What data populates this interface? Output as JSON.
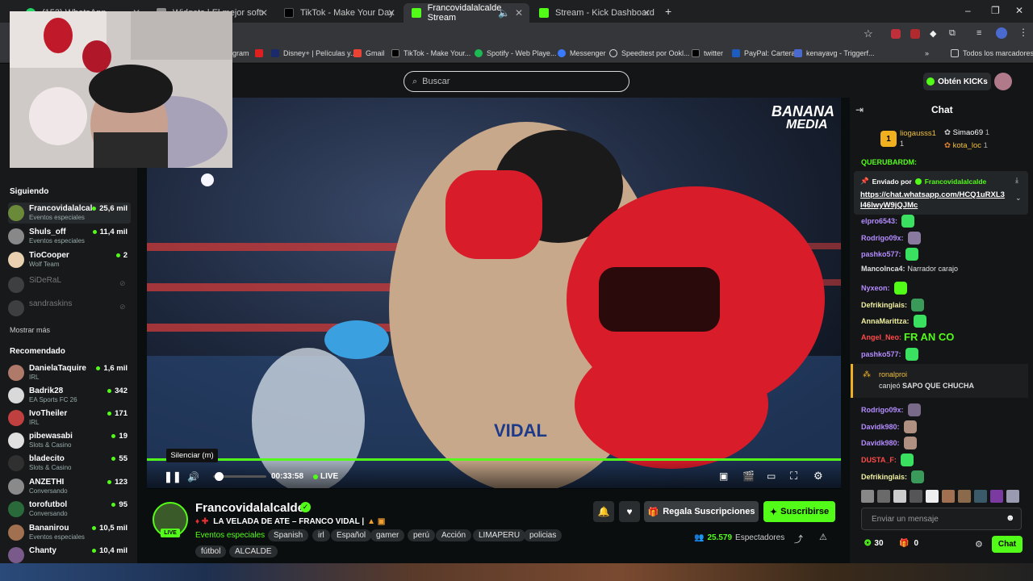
{
  "browser": {
    "tabs": [
      {
        "label": "(153) WhatsApp",
        "color": "#25d366"
      },
      {
        "label": "Widgets | El mejor software pa",
        "color": "#8a8a8a"
      },
      {
        "label": "TikTok - Make Your Day",
        "color": "#111111"
      },
      {
        "label": "Francovidalalcalde Stream",
        "color": "#53fc18"
      },
      {
        "label": "Stream - Kick Dashboard",
        "color": "#53fc18"
      }
    ],
    "new_tab": "+",
    "bookmarks": [
      "gram",
      "Disney+ | Películas y...",
      "Gmail",
      "TikTok - Make Your...",
      "Spotify - Web Playe...",
      "Messenger",
      "Speedtest por Ookl...",
      "twitter",
      "PayPal: Cartera",
      "kenayavg - Triggerf..."
    ],
    "all_bookmarks": "Todos los marcadores"
  },
  "header": {
    "search_placeholder": "Buscar",
    "kicks_button": "Obtén KICKs"
  },
  "sidebar": {
    "following_title": "Siguiendo",
    "following": [
      {
        "name": "Francovidalalcalde",
        "category": "Eventos especiales",
        "viewers": "25,6 mil",
        "color": "#6a8a3a"
      },
      {
        "name": "Shuls_off",
        "category": "Eventos especiales",
        "viewers": "11,4 mil",
        "color": "#888888"
      },
      {
        "name": "TioCooper",
        "category": "Wolf Team",
        "viewers": "2",
        "color": "#e8d0b0"
      },
      {
        "name": "SiDeRaL",
        "category": "",
        "viewers": "",
        "color": "#777777"
      },
      {
        "name": "sandraskins",
        "category": "",
        "viewers": "",
        "color": "#777777"
      }
    ],
    "show_more": "Mostrar más",
    "recommended_title": "Recomendado",
    "recommended": [
      {
        "name": "DanielaTaquire",
        "category": "IRL",
        "viewers": "1,6 mil",
        "color": "#b07a6a"
      },
      {
        "name": "Badrik28",
        "category": "EA Sports FC 26",
        "viewers": "342",
        "color": "#d9d9d9"
      },
      {
        "name": "IvoTheiler",
        "category": "IRL",
        "viewers": "171",
        "color": "#c04040"
      },
      {
        "name": "pibewasabi",
        "category": "Slots & Casino",
        "viewers": "19",
        "color": "#e0e0e0"
      },
      {
        "name": "bladecito",
        "category": "Slots & Casino",
        "viewers": "55",
        "color": "#303030"
      },
      {
        "name": "ANZETHI",
        "category": "Conversando",
        "viewers": "123",
        "color": "#8a8a8a"
      },
      {
        "name": "torofutbol",
        "category": "Conversando",
        "viewers": "95",
        "color": "#2a6a3a"
      },
      {
        "name": "Bananirou",
        "category": "Eventos especiales",
        "viewers": "10,5 mil",
        "color": "#a07050"
      },
      {
        "name": "Chanty",
        "category": "",
        "viewers": "10,4 mil",
        "color": "#7a5a8a"
      }
    ]
  },
  "player": {
    "watermark_line1": "BANANA",
    "watermark_line2": "MEDIA",
    "tooltip": "Silenciar (m)",
    "time": "00:33:58",
    "live": "LIVE",
    "progress": 1.0
  },
  "stream": {
    "channel": "Francovidalalcalde",
    "live_badge": "LIVE",
    "title": "LA VELADA DE ATE – FRANCO VIDAL |",
    "category": "Eventos especiales",
    "tags_row1": [
      "Spanish",
      "irl",
      "Español",
      "gamer",
      "perú",
      "Acción",
      "LIMAPERU",
      "policias"
    ],
    "tags_row2": [
      "fútbol",
      "ALCALDE"
    ],
    "gift_button": "Regala Suscripciones",
    "subscribe_button": "Suscribirse",
    "viewers": "25.579",
    "viewers_label": "Espectadores"
  },
  "chat": {
    "title": "Chat",
    "top_gifters": [
      {
        "name": "liogausss1",
        "count": "1"
      },
      {
        "name": "Simao69",
        "count": "1"
      },
      {
        "name": "kota_loc",
        "count": "1"
      }
    ],
    "partial_user": "QUERUBARDM:",
    "pinned_by_label": "Enviado por",
    "pinned_by_user": "Francovidalalcalde",
    "pinned_link": "https://chat.whatsapp.com/HCQ1uRXL3I46lwyW9jQJMc",
    "messages": [
      {
        "user": "elpro6543:",
        "text": "",
        "color": "#b48cff"
      },
      {
        "user": "Rodrigo09x:",
        "text": "",
        "color": "#b48cff"
      },
      {
        "user": "pashko577:",
        "text": "",
        "color": "#b48cff"
      },
      {
        "user": "Mancolnca4:",
        "text": "Narrador carajo",
        "color": "#e0e0e0"
      },
      {
        "user": "Nyxeon:",
        "text": "",
        "color": "#b48cff"
      },
      {
        "user": "Defrikinglais:",
        "text": "",
        "color": "#f0f0a0"
      },
      {
        "user": "AnnaMarittza:",
        "text": "",
        "color": "#f0f0a0"
      },
      {
        "user": "Angel_Neo:",
        "text": "FR AN CO",
        "color": "#ff4a4a"
      },
      {
        "user": "pashko577:",
        "text": "",
        "color": "#b48cff"
      }
    ],
    "redeem_user": "ronalproi",
    "redeem_text": "canjeó",
    "redeem_item": "SAPO QUE CHUCHA",
    "messages2": [
      {
        "user": "Rodrigo09x:",
        "text": "",
        "color": "#b48cff"
      },
      {
        "user": "Davidk980:",
        "text": "",
        "color": "#b48cff"
      },
      {
        "user": "Davidk980:",
        "text": "",
        "color": "#b48cff"
      },
      {
        "user": "DUSTA_F:",
        "text": "",
        "color": "#ff4a4a"
      },
      {
        "user": "Defrikinglais:",
        "text": "",
        "color": "#f0f0a0"
      }
    ],
    "input_placeholder": "Enviar un mensaje",
    "kicks_count": "30",
    "gift_count": "0",
    "send_button": "Chat"
  },
  "colors": {
    "accent": "#53fc18",
    "bg": "#0b0e0f",
    "panel": "#141517"
  }
}
